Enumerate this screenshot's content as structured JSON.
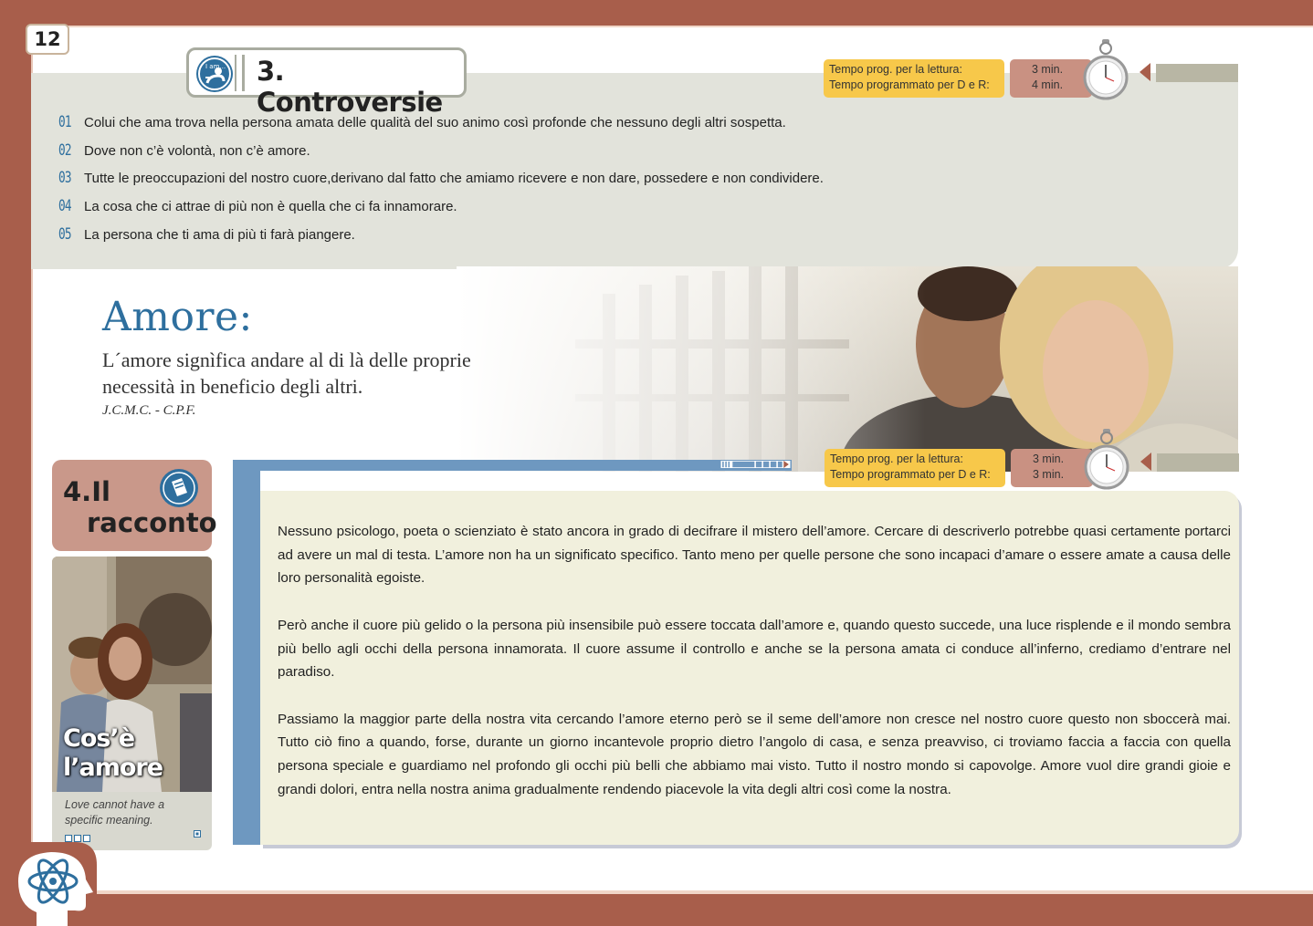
{
  "page_number": "12",
  "controversie": {
    "icon_text": "I am...",
    "title": "3. Controversie",
    "timer": {
      "label_reading": "Tempo prog. per la lettura:",
      "label_dr": "Tempo programmato per D e R:",
      "value_reading": "3 min.",
      "value_dr": "4 min."
    },
    "items": [
      {
        "num": "01",
        "text": "Colui che ama trova nella persona amata delle qualità del suo animo così profonde che nessuno degli altri sospetta."
      },
      {
        "num": "02",
        "text": "Dove non c’è volontà, non c’è amore."
      },
      {
        "num": "03",
        "text": "Tutte le preoccupazioni del nostro cuore,derivano dal fatto che amiamo ricevere e non dare, possedere e non condividere."
      },
      {
        "num": "04",
        "text": "La cosa che ci attrae di più non è quella che ci fa innamorare."
      },
      {
        "num": "05",
        "text": "La persona che ti ama di più ti farà piangere."
      }
    ]
  },
  "amore": {
    "title": "Amore:",
    "quote_line1": "L´amore signìfica andare al di là delle proprie",
    "quote_line2": "necessità in beneficio degli altri.",
    "author": "J.C.M.C. - C.P.F."
  },
  "racconto": {
    "number": "4.Il",
    "word": "racconto",
    "photo_title_line1": "Cos’è",
    "photo_title_line2": "l’amore",
    "caption_line1": "Love cannot have a",
    "caption_line2": "specific meaning.",
    "timer": {
      "label_reading": "Tempo prog. per la lettura:",
      "label_dr": "Tempo programmato per D e R:",
      "value_reading": "3 min.",
      "value_dr": "3 min."
    },
    "paragraphs": [
      "Nessuno psicologo, poeta o scienziato è stato ancora in grado di decifrare il mistero dell’amore. Cercare di descriverlo potrebbe quasi certamente portarci ad avere un mal di testa. L’amore non ha un significato specifico. Tanto meno per quelle persone che sono incapaci d’amare o essere amate a causa delle loro personalità egoiste.",
      "Però anche il cuore più gelido o la persona più insensibile può essere toccata dall’amore e, quando questo succede, una luce risplende e il mondo sembra più bello agli occhi della persona innamorata.  Il cuore assume il controllo e anche se la persona amata ci conduce all’inferno, crediamo d’entrare nel paradiso.",
      "Passiamo la maggior parte della nostra vita cercando l’amore eterno però se il seme dell’amore non cresce nel nostro cuore questo non sboccerà mai. Tutto ciò fino a quando, forse, durante un giorno incantevole proprio dietro l’angolo di casa, e senza preavviso, ci troviamo faccia a faccia con quella persona speciale e guardiamo nel profondo gli occhi più belli che abbiamo mai visto. Tutto il nostro mondo si capovolge. Amore vuol dire grandi gioie e grandi dolori, entra nella nostra anima gradualmente rendendo piacevole la vita degli altri così come la nostra."
    ]
  },
  "colors": {
    "frame": "#a85e4b",
    "accent_blue": "#2e6f9e",
    "panel_grey": "#e2e3db",
    "panel_cream": "#f1f0dd",
    "timer_yellow": "#f7c84a",
    "timer_pink": "#c99182"
  }
}
